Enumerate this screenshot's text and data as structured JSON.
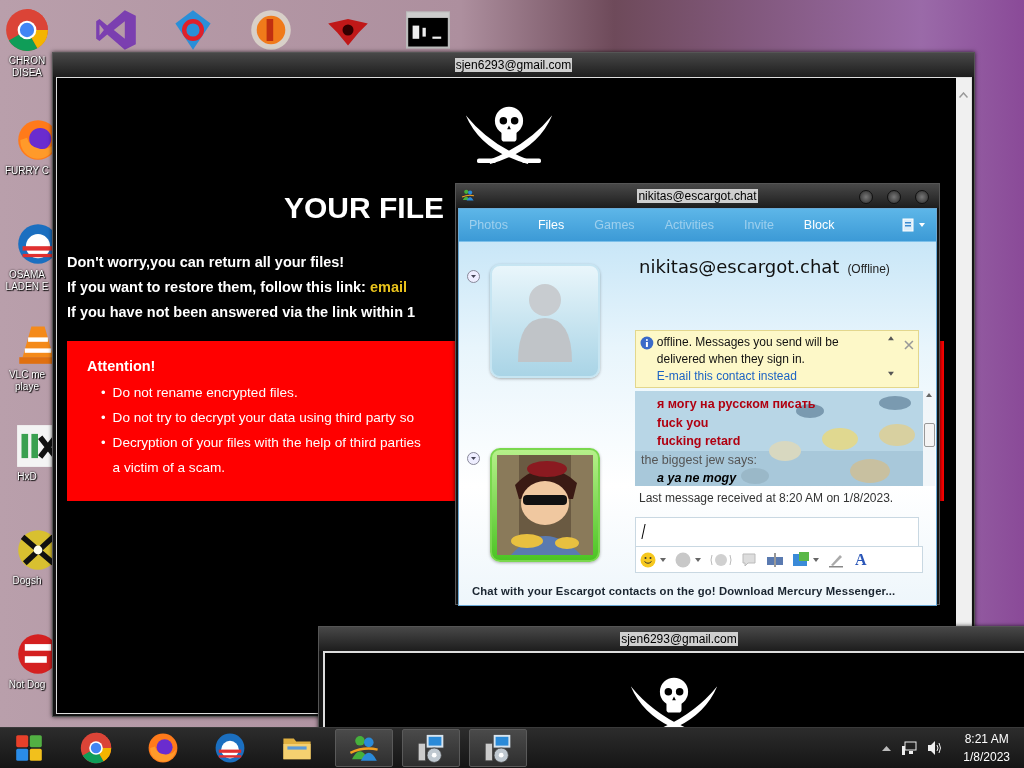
{
  "desktop_icons": [
    {
      "kind": "chrome",
      "label": "CHRON\nDISEA"
    },
    {
      "kind": "visual-studio"
    },
    {
      "kind": "gem"
    },
    {
      "kind": "ball"
    },
    {
      "kind": "emblem"
    },
    {
      "kind": "terminal"
    },
    {
      "kind": "firefox",
      "label": "FURRY C"
    },
    {
      "kind": "obama",
      "label": "OSAMA\nLADEN E"
    },
    {
      "kind": "vlc",
      "label": "VLC me\nplaye"
    },
    {
      "kind": "hxd",
      "label": "HxD"
    },
    {
      "kind": "disc",
      "label": "Dogsh"
    },
    {
      "kind": "devcpp",
      "label": "Not Dog"
    }
  ],
  "ransom_window": {
    "title": "sjen6293@gmail.com",
    "heading": "YOUR FILE",
    "lines": [
      {
        "text": "Don't worry,you can return all your files!"
      },
      {
        "text": "If you want to restore them, follow this link: ",
        "link": "email"
      },
      {
        "text": "If you have not been answered via the link within 1"
      }
    ],
    "attention": {
      "title": "Attention!",
      "bullet": "•",
      "items": [
        [
          "Do not rename encrypted files."
        ],
        [
          "Do not try to decrypt your data using third party so"
        ],
        [
          "Decryption of your files with the help of third parties",
          "a victim of a scam."
        ]
      ]
    }
  },
  "chat_window": {
    "title": "nikitas@escargot.chat",
    "tabs": [
      {
        "label": "Photos",
        "disabled": true
      },
      {
        "label": "Files",
        "disabled": false
      },
      {
        "label": "Games",
        "disabled": true
      },
      {
        "label": "Activities",
        "disabled": true
      },
      {
        "label": "Invite",
        "disabled": true
      },
      {
        "label": "Block",
        "disabled": false
      }
    ],
    "contact": {
      "name": "nikitas@escargot.chat",
      "status": "(Offline)"
    },
    "info_bar": {
      "text": "offline. Messages you send will be delivered when they sign in. ",
      "link": "E-mail this contact instead"
    },
    "messages": [
      {
        "kind": "sent",
        "text": "я могу на русском писать"
      },
      {
        "kind": "sent",
        "text": "fuck you"
      },
      {
        "kind": "sent",
        "text": "fucking retard"
      },
      {
        "kind": "sender",
        "text": "the biggest jew says:"
      },
      {
        "kind": "received",
        "text": "a ya ne mogy"
      }
    ],
    "last_message": "Last message received at 8:20 AM on 1/8/2023.",
    "format_tools": [
      {
        "kind": "emoticon"
      },
      {
        "kind": "wink"
      },
      {
        "kind": "nudge"
      },
      {
        "kind": "voice"
      },
      {
        "kind": "font"
      },
      {
        "kind": "background"
      },
      {
        "kind": "pen"
      },
      {
        "kind": "text-color",
        "label": "A"
      }
    ],
    "footer": "Chat with your Escargot contacts on the go! Download Mercury Messenger..."
  },
  "third_window": {
    "title": "sjen6293@gmail.com"
  },
  "taskbar": {
    "apps": [
      {
        "kind": "start",
        "running": false
      },
      {
        "kind": "chrome",
        "running": false
      },
      {
        "kind": "firefox",
        "running": false
      },
      {
        "kind": "obama",
        "running": false
      },
      {
        "kind": "folder",
        "running": false
      },
      {
        "kind": "messenger",
        "running": true
      },
      {
        "kind": "installer",
        "running": true
      },
      {
        "kind": "installer",
        "running": true
      }
    ],
    "clock": {
      "time": "8:21 AM",
      "date": "1/8/2023"
    }
  }
}
